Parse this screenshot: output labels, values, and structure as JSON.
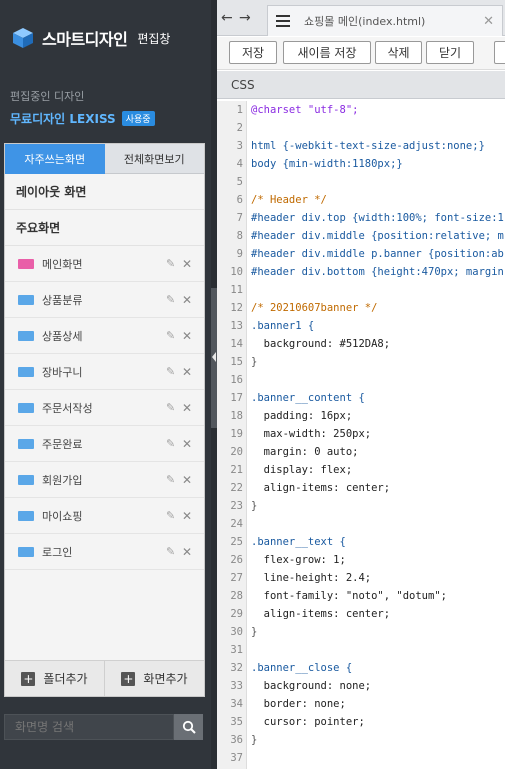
{
  "app": {
    "title": "스마트디자인",
    "subtitle": "편집창"
  },
  "editing": {
    "label": "편집중인 디자인",
    "design_name": "무료디자인 LEXISS",
    "status_badge": "사용중"
  },
  "panel": {
    "tabs": [
      {
        "label": "자주쓰는화면",
        "active": true
      },
      {
        "label": "전체화면보기",
        "active": false
      }
    ],
    "sections": [
      {
        "label": "레이아웃 화면"
      },
      {
        "label": "주요화면"
      }
    ],
    "pages": [
      {
        "label": "메인화면",
        "icon": "page-main-icon"
      },
      {
        "label": "상품분류",
        "icon": "page-icon"
      },
      {
        "label": "상품상세",
        "icon": "page-icon"
      },
      {
        "label": "장바구니",
        "icon": "page-icon"
      },
      {
        "label": "주문서작성",
        "icon": "page-icon"
      },
      {
        "label": "주문완료",
        "icon": "page-icon"
      },
      {
        "label": "회원가입",
        "icon": "page-icon"
      },
      {
        "label": "마이쇼핑",
        "icon": "page-icon"
      },
      {
        "label": "로그인",
        "icon": "page-icon"
      }
    ],
    "bottom_buttons": {
      "add_folder": "폴더추가",
      "add_page": "화면추가"
    }
  },
  "search": {
    "placeholder": "화면명 검색"
  },
  "editor": {
    "file_tab": "쇼핑몰 메인(index.html)",
    "toolbar": {
      "save": "저장",
      "save_as": "새이름 저장",
      "delete": "삭제",
      "close": "닫기"
    },
    "section_label": "CSS",
    "lines": [
      {
        "n": "1",
        "t": "@charset \"utf-8\";",
        "k": "at"
      },
      {
        "n": "2",
        "t": "",
        "k": "plain"
      },
      {
        "n": "3",
        "t": "html {-webkit-text-size-adjust:none;}",
        "k": "sel"
      },
      {
        "n": "4",
        "t": "body {min-width:1180px;}",
        "k": "sel"
      },
      {
        "n": "5",
        "t": "",
        "k": "plain"
      },
      {
        "n": "6",
        "t": "/* Header */",
        "k": "comment"
      },
      {
        "n": "7",
        "t": "#header div.top {width:100%; font-size:1",
        "k": "sel"
      },
      {
        "n": "8",
        "t": "#header div.middle {position:relative; m",
        "k": "sel"
      },
      {
        "n": "9",
        "t": "#header div.middle p.banner {position:ab",
        "k": "sel"
      },
      {
        "n": "10",
        "t": "#header div.bottom {height:470px; margin",
        "k": "sel"
      },
      {
        "n": "11",
        "t": "",
        "k": "plain"
      },
      {
        "n": "12",
        "t": "/* 20210607banner */",
        "k": "comment"
      },
      {
        "n": "13",
        "t": ".banner1 {",
        "k": "sel"
      },
      {
        "n": "14",
        "t": "  background: #512DA8;",
        "k": "prop"
      },
      {
        "n": "15",
        "t": "}",
        "k": "plain"
      },
      {
        "n": "16",
        "t": "",
        "k": "plain"
      },
      {
        "n": "17",
        "t": ".banner__content {",
        "k": "sel"
      },
      {
        "n": "18",
        "t": "  padding: 16px;",
        "k": "prop"
      },
      {
        "n": "19",
        "t": "  max-width: 250px;",
        "k": "prop"
      },
      {
        "n": "20",
        "t": "  margin: 0 auto;",
        "k": "prop"
      },
      {
        "n": "21",
        "t": "  display: flex;",
        "k": "prop"
      },
      {
        "n": "22",
        "t": "  align-items: center;",
        "k": "prop"
      },
      {
        "n": "23",
        "t": "}",
        "k": "plain"
      },
      {
        "n": "24",
        "t": "",
        "k": "plain"
      },
      {
        "n": "25",
        "t": ".banner__text {",
        "k": "sel"
      },
      {
        "n": "26",
        "t": "  flex-grow: 1;",
        "k": "prop"
      },
      {
        "n": "27",
        "t": "  line-height: 2.4;",
        "k": "prop"
      },
      {
        "n": "28",
        "t": "  font-family: \"noto\", \"dotum\";",
        "k": "prop"
      },
      {
        "n": "29",
        "t": "  align-items: center;",
        "k": "prop"
      },
      {
        "n": "30",
        "t": "}",
        "k": "plain"
      },
      {
        "n": "31",
        "t": "",
        "k": "plain"
      },
      {
        "n": "32",
        "t": ".banner__close {",
        "k": "sel"
      },
      {
        "n": "33",
        "t": "  background: none;",
        "k": "prop"
      },
      {
        "n": "34",
        "t": "  border: none;",
        "k": "prop"
      },
      {
        "n": "35",
        "t": "  cursor: pointer;",
        "k": "prop"
      },
      {
        "n": "36",
        "t": "}",
        "k": "plain"
      },
      {
        "n": "37",
        "t": "",
        "k": "plain"
      }
    ]
  }
}
